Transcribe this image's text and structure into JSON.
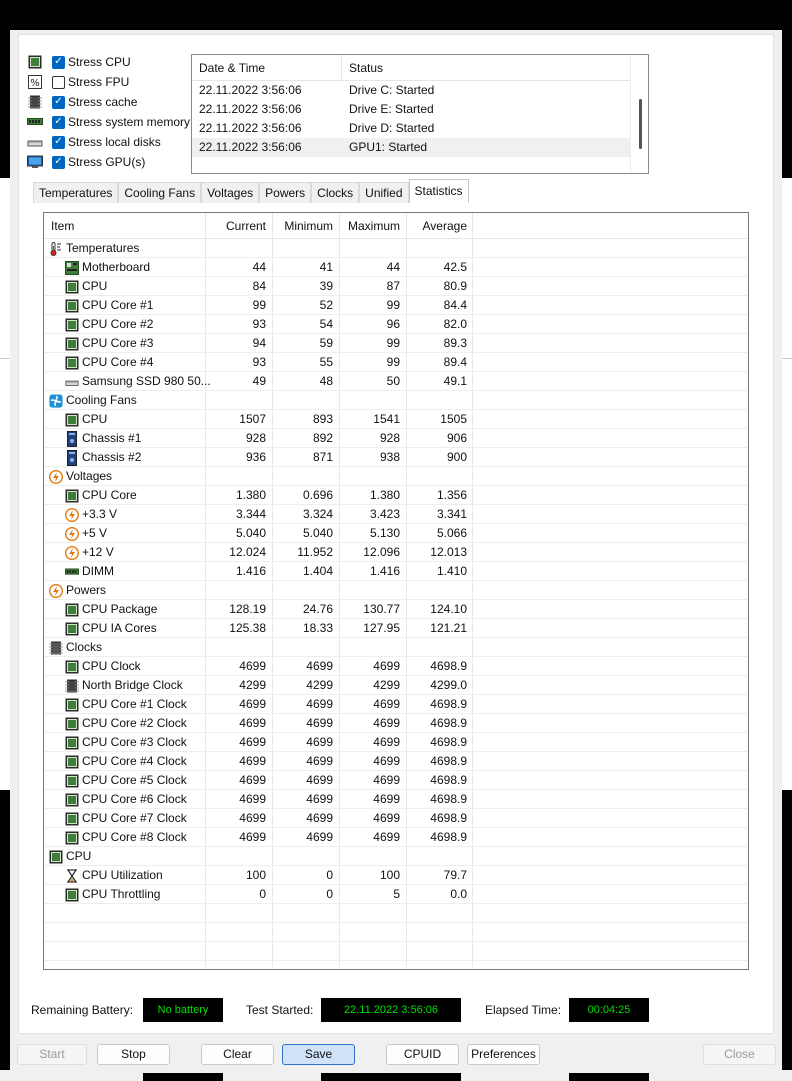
{
  "stress": [
    {
      "label": "Stress CPU",
      "checked": true,
      "icon": "cpu-chip-icon"
    },
    {
      "label": "Stress FPU",
      "checked": false,
      "icon": "percent-chip-icon"
    },
    {
      "label": "Stress cache",
      "checked": true,
      "icon": "cache-chip-icon"
    },
    {
      "label": "Stress system memory",
      "checked": true,
      "icon": "memory-module-icon"
    },
    {
      "label": "Stress local disks",
      "checked": true,
      "icon": "disk-drive-icon"
    },
    {
      "label": "Stress GPU(s)",
      "checked": true,
      "icon": "monitor-icon"
    }
  ],
  "log": {
    "col_datetime": "Date & Time",
    "col_status": "Status",
    "rows": [
      {
        "datetime": "22.11.2022 3:56:06",
        "status": "Drive C: Started"
      },
      {
        "datetime": "22.11.2022 3:56:06",
        "status": "Drive E: Started"
      },
      {
        "datetime": "22.11.2022 3:56:06",
        "status": "Drive D: Started"
      },
      {
        "datetime": "22.11.2022 3:56:06",
        "status": "GPU1: Started"
      }
    ]
  },
  "tabs": [
    "Temperatures",
    "Cooling Fans",
    "Voltages",
    "Powers",
    "Clocks",
    "Unified",
    "Statistics"
  ],
  "active_tab": "Statistics",
  "stats": {
    "headers": {
      "item": "Item",
      "current": "Current",
      "minimum": "Minimum",
      "maximum": "Maximum",
      "average": "Average"
    },
    "rows": [
      {
        "type": "group",
        "name": "Temperatures",
        "icon": "thermometer-icon"
      },
      {
        "type": "item",
        "name": "Motherboard",
        "icon": "motherboard-icon",
        "cur": "44",
        "min": "41",
        "max": "44",
        "avg": "42.5"
      },
      {
        "type": "item",
        "name": "CPU",
        "icon": "cpu-chip-icon",
        "cur": "84",
        "min": "39",
        "max": "87",
        "avg": "80.9"
      },
      {
        "type": "item",
        "name": "CPU Core #1",
        "icon": "cpu-chip-icon",
        "cur": "99",
        "min": "52",
        "max": "99",
        "avg": "84.4"
      },
      {
        "type": "item",
        "name": "CPU Core #2",
        "icon": "cpu-chip-icon",
        "cur": "93",
        "min": "54",
        "max": "96",
        "avg": "82.0"
      },
      {
        "type": "item",
        "name": "CPU Core #3",
        "icon": "cpu-chip-icon",
        "cur": "94",
        "min": "59",
        "max": "99",
        "avg": "89.3"
      },
      {
        "type": "item",
        "name": "CPU Core #4",
        "icon": "cpu-chip-icon",
        "cur": "93",
        "min": "55",
        "max": "99",
        "avg": "89.4"
      },
      {
        "type": "item",
        "name": "Samsung SSD 980 50...",
        "icon": "disk-drive-icon",
        "cur": "49",
        "min": "48",
        "max": "50",
        "avg": "49.1"
      },
      {
        "type": "group",
        "name": "Cooling Fans",
        "icon": "fan-icon"
      },
      {
        "type": "item",
        "name": "CPU",
        "icon": "cpu-chip-icon",
        "cur": "1507",
        "min": "893",
        "max": "1541",
        "avg": "1505"
      },
      {
        "type": "item",
        "name": "Chassis #1",
        "icon": "chassis-icon",
        "cur": "928",
        "min": "892",
        "max": "928",
        "avg": "906"
      },
      {
        "type": "item",
        "name": "Chassis #2",
        "icon": "chassis-icon",
        "cur": "936",
        "min": "871",
        "max": "938",
        "avg": "900"
      },
      {
        "type": "group",
        "name": "Voltages",
        "icon": "bolt-icon"
      },
      {
        "type": "item",
        "name": "CPU Core",
        "icon": "cpu-chip-icon",
        "cur": "1.380",
        "min": "0.696",
        "max": "1.380",
        "avg": "1.356"
      },
      {
        "type": "item",
        "name": "+3.3 V",
        "icon": "bolt-icon",
        "cur": "3.344",
        "min": "3.324",
        "max": "3.423",
        "avg": "3.341"
      },
      {
        "type": "item",
        "name": "+5 V",
        "icon": "bolt-icon",
        "cur": "5.040",
        "min": "5.040",
        "max": "5.130",
        "avg": "5.066"
      },
      {
        "type": "item",
        "name": "+12 V",
        "icon": "bolt-icon",
        "cur": "12.024",
        "min": "11.952",
        "max": "12.096",
        "avg": "12.013"
      },
      {
        "type": "item",
        "name": "DIMM",
        "icon": "memory-module-icon",
        "cur": "1.416",
        "min": "1.404",
        "max": "1.416",
        "avg": "1.410"
      },
      {
        "type": "group",
        "name": "Powers",
        "icon": "bolt-icon"
      },
      {
        "type": "item",
        "name": "CPU Package",
        "icon": "cpu-chip-icon",
        "cur": "128.19",
        "min": "24.76",
        "max": "130.77",
        "avg": "124.10"
      },
      {
        "type": "item",
        "name": "CPU IA Cores",
        "icon": "cpu-chip-icon",
        "cur": "125.38",
        "min": "18.33",
        "max": "127.95",
        "avg": "121.21"
      },
      {
        "type": "group",
        "name": "Clocks",
        "icon": "clock-chip-icon"
      },
      {
        "type": "item",
        "name": "CPU Clock",
        "icon": "cpu-chip-icon",
        "cur": "4699",
        "min": "4699",
        "max": "4699",
        "avg": "4698.9"
      },
      {
        "type": "item",
        "name": "North Bridge Clock",
        "icon": "cache-chip-icon",
        "cur": "4299",
        "min": "4299",
        "max": "4299",
        "avg": "4299.0"
      },
      {
        "type": "item",
        "name": "CPU Core #1 Clock",
        "icon": "cpu-chip-icon",
        "cur": "4699",
        "min": "4699",
        "max": "4699",
        "avg": "4698.9"
      },
      {
        "type": "item",
        "name": "CPU Core #2 Clock",
        "icon": "cpu-chip-icon",
        "cur": "4699",
        "min": "4699",
        "max": "4699",
        "avg": "4698.9"
      },
      {
        "type": "item",
        "name": "CPU Core #3 Clock",
        "icon": "cpu-chip-icon",
        "cur": "4699",
        "min": "4699",
        "max": "4699",
        "avg": "4698.9"
      },
      {
        "type": "item",
        "name": "CPU Core #4 Clock",
        "icon": "cpu-chip-icon",
        "cur": "4699",
        "min": "4699",
        "max": "4699",
        "avg": "4698.9"
      },
      {
        "type": "item",
        "name": "CPU Core #5 Clock",
        "icon": "cpu-chip-icon",
        "cur": "4699",
        "min": "4699",
        "max": "4699",
        "avg": "4698.9"
      },
      {
        "type": "item",
        "name": "CPU Core #6 Clock",
        "icon": "cpu-chip-icon",
        "cur": "4699",
        "min": "4699",
        "max": "4699",
        "avg": "4698.9"
      },
      {
        "type": "item",
        "name": "CPU Core #7 Clock",
        "icon": "cpu-chip-icon",
        "cur": "4699",
        "min": "4699",
        "max": "4699",
        "avg": "4698.9"
      },
      {
        "type": "item",
        "name": "CPU Core #8 Clock",
        "icon": "cpu-chip-icon",
        "cur": "4699",
        "min": "4699",
        "max": "4699",
        "avg": "4698.9"
      },
      {
        "type": "group",
        "name": "CPU",
        "icon": "cpu-chip-icon"
      },
      {
        "type": "item",
        "name": "CPU Utilization",
        "icon": "hourglass-icon",
        "cur": "100",
        "min": "0",
        "max": "100",
        "avg": "79.7"
      },
      {
        "type": "item",
        "name": "CPU Throttling",
        "icon": "cpu-chip-icon",
        "cur": "0",
        "min": "0",
        "max": "5",
        "avg": "0.0"
      }
    ]
  },
  "info": {
    "battery_label": "Remaining Battery:",
    "battery_value": "No battery",
    "started_label": "Test Started:",
    "started_value": "22.11.2022 3:56:06",
    "elapsed_label": "Elapsed Time:",
    "elapsed_value": "00:04:25"
  },
  "buttons": {
    "start": "Start",
    "stop": "Stop",
    "clear": "Clear",
    "save": "Save",
    "cpuid": "CPUID",
    "preferences": "Preferences",
    "close": "Close"
  },
  "colors": {
    "info_text": "#00e000",
    "checkbox": "#0067c0",
    "chip_green": "#3f7d3a",
    "fan_blue": "#1e90d6",
    "bolt_orange": "#e07a10"
  }
}
